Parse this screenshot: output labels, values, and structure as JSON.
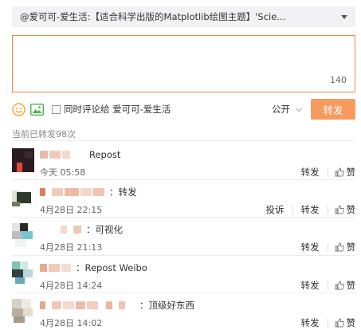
{
  "quote": {
    "text": "@爱可可-爱生活:【适合科学出版的Matplotlib绘图主题】'Scie..."
  },
  "composer": {
    "char_count": "140",
    "comment_label": "同时评论给 爱可可-爱生活",
    "visibility": "公开",
    "submit_label": "转发"
  },
  "repost_count": "当前已转发98次",
  "reposts": [
    {
      "message": "Repost",
      "time": "今天 05:58",
      "actions": [
        "转发",
        "赞"
      ]
    },
    {
      "message": "：转发",
      "time": "4月28日 22:15",
      "actions": [
        "投诉",
        "转发",
        "赞"
      ]
    },
    {
      "message": "：可视化",
      "time": "4月28日 21:13",
      "actions": [
        "转发",
        "赞"
      ]
    },
    {
      "message": "：Repost Weibo",
      "time": "4月28日 14:24",
      "actions": [
        "转发",
        "赞"
      ]
    },
    {
      "message": "：顶级好东西",
      "time": "4月28日 14:02",
      "actions": [
        "转发",
        "赞"
      ]
    }
  ],
  "colors": {
    "accent": "#f79a5d",
    "textarea_border": "#ef8a48",
    "emoji_icon": "#f5a623",
    "image_icon": "#4caf50"
  }
}
